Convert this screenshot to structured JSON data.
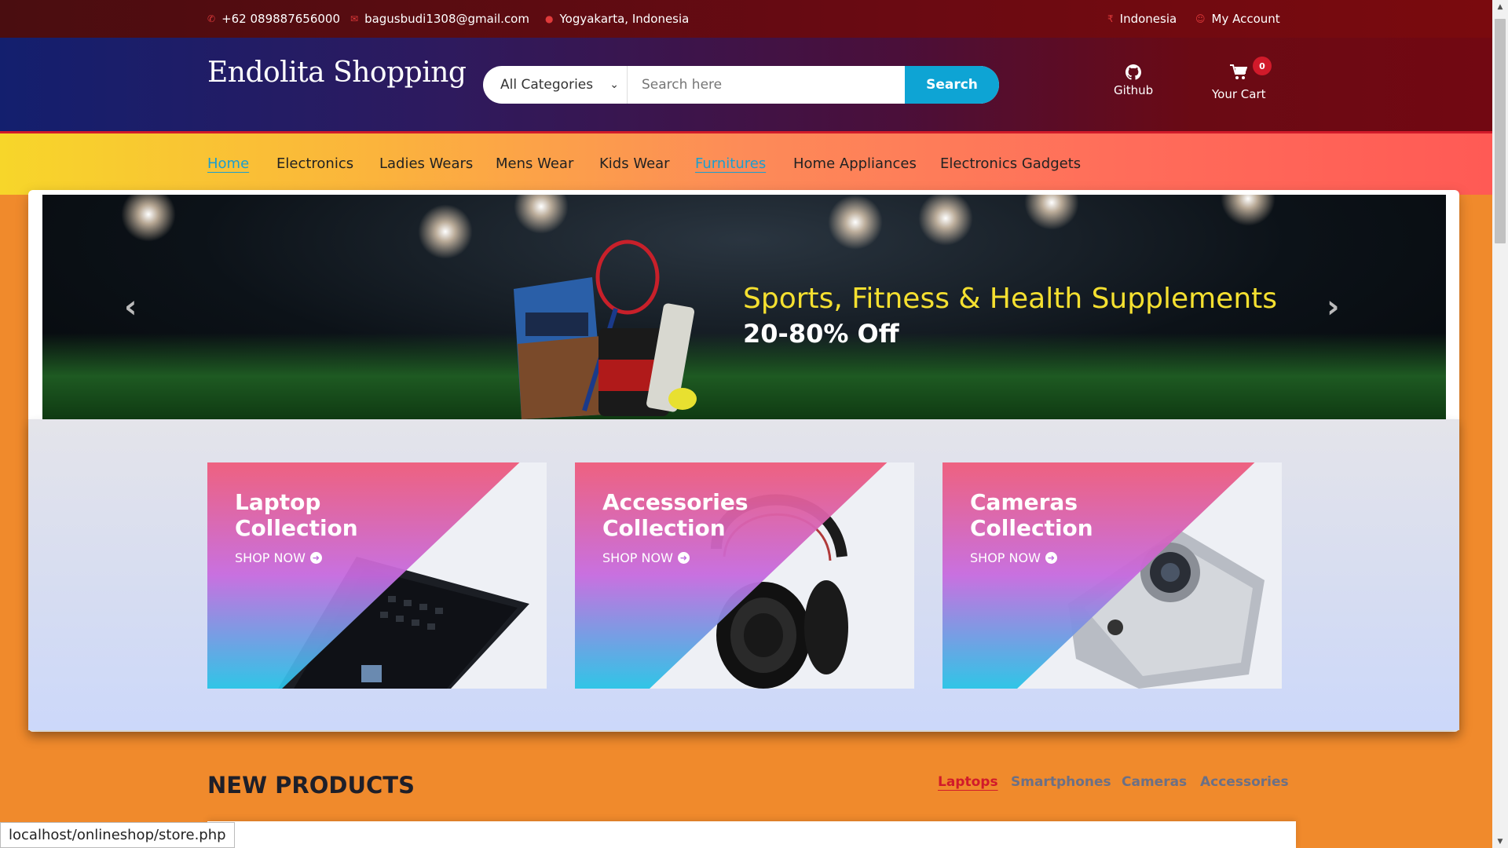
{
  "topbar": {
    "phone": "+62 089887656000",
    "email": "bagusbudi1308@gmail.com",
    "location": "Yogyakarta, Indonesia",
    "country": "Indonesia",
    "account": "My Account"
  },
  "header": {
    "logo": "Endolita Shopping",
    "search": {
      "category": "All Categories",
      "placeholder": "Search here",
      "button": "Search"
    },
    "github_label": "Github",
    "cart_label": "Your Cart",
    "cart_count": "0"
  },
  "nav": {
    "items": [
      "Home",
      "Electronics",
      "Ladies Wears",
      "Mens Wear",
      "Kids Wear",
      "Furnitures",
      "Home Appliances",
      "Electronics Gadgets"
    ],
    "active": "Home"
  },
  "banner": {
    "title": "Sports, Fitness & Health Supplements",
    "subtitle": "20-80% Off"
  },
  "collections": [
    {
      "title_line1": "Laptop",
      "title_line2": "Collection",
      "cta": "SHOP NOW"
    },
    {
      "title_line1": "Accessories",
      "title_line2": "Collection",
      "cta": "SHOP NOW"
    },
    {
      "title_line1": "Cameras",
      "title_line2": "Collection",
      "cta": "SHOP NOW"
    }
  ],
  "new_products": {
    "title": "NEW PRODUCTS",
    "tabs": [
      "Laptops",
      "Smartphones",
      "Cameras",
      "Accessories"
    ],
    "active_tab": "Laptops"
  },
  "statusbar": {
    "url": "localhost/onlineshop/store.php"
  },
  "colors": {
    "accent": "#d11a2a",
    "search_button": "#0ea4d4",
    "link_active": "#1a9ed0",
    "banner_title": "#f5e030"
  },
  "icons": [
    "phone-icon",
    "email-icon",
    "map-marker-icon",
    "github-icon",
    "cart-icon",
    "chevron-left-icon",
    "chevron-right-icon",
    "arrow-circle-right-icon"
  ]
}
